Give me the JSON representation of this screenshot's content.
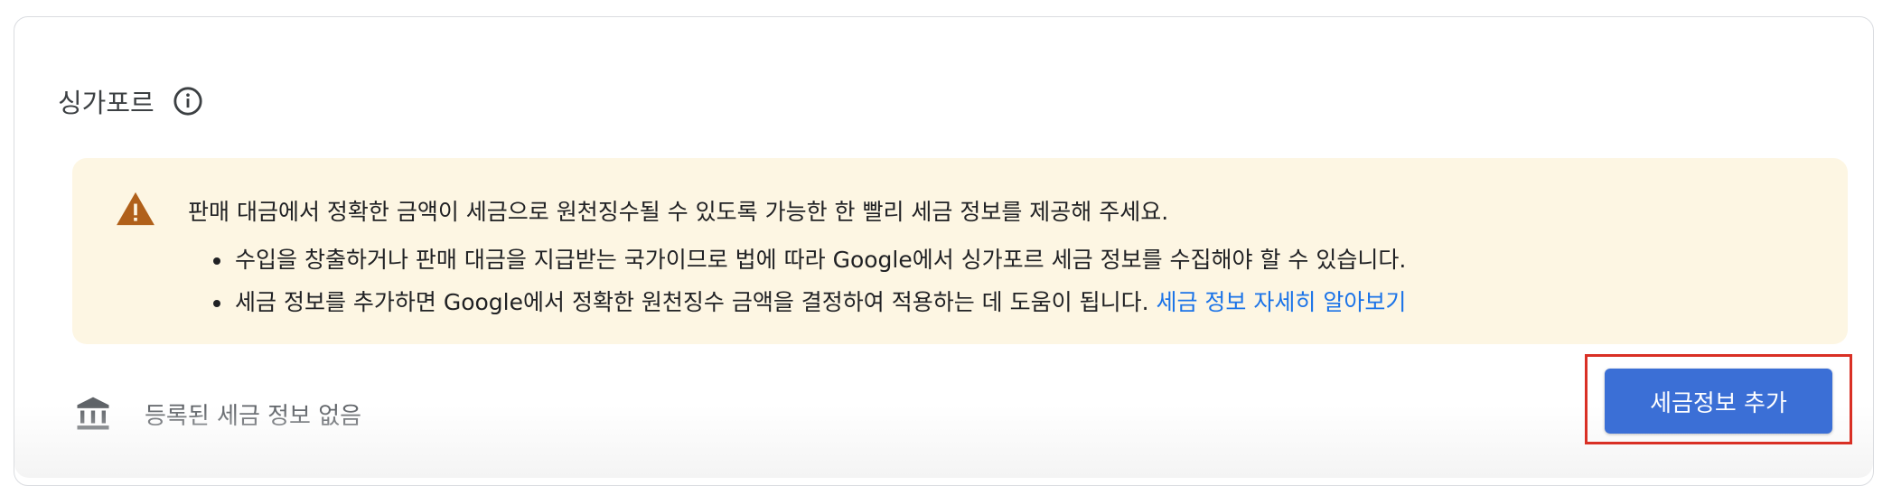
{
  "section": {
    "title": "싱가포르"
  },
  "alert": {
    "message": "판매 대금에서 정확한 금액이 세금으로 원천징수될 수 있도록 가능한 한 빨리 세금 정보를 제공해 주세요.",
    "bullets": [
      "수입을 창출하거나 판매 대금을 지급받는 국가이므로 법에 따라 Google에서 싱가포르 세금 정보를 수집해야 할 수 있습니다.",
      "세금 정보를 추가하면 Google에서 정확한 원천징수 금액을 결정하여 적용하는 데 도움이 됩니다."
    ],
    "link_text": "세금 정보 자세히 알아보기",
    "icon": "warning-icon",
    "color": "#fdf6e3",
    "icon_color": "#b0601a"
  },
  "tax_info": {
    "empty_text": "등록된 세금 정보 없음",
    "icon": "bank-icon"
  },
  "actions": {
    "add_button_label": "세금정보 추가",
    "button_color": "#3b6fd6",
    "highlight_color": "#d93025"
  }
}
